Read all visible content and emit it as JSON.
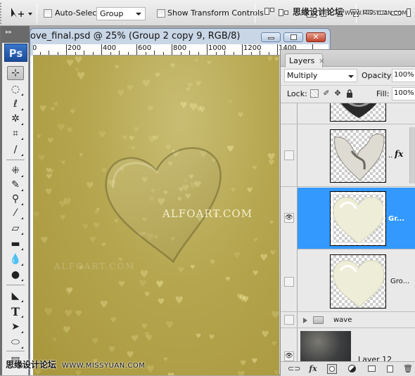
{
  "options_bar": {
    "auto_select_label": "Auto-Select:",
    "auto_select_checked": false,
    "auto_select_value": "Group",
    "show_transform_label": "Show Transform Controls",
    "show_transform_checked": false
  },
  "tools": {
    "panel_header": "▸▸",
    "logo": "Ps",
    "items": [
      {
        "name": "move-tool",
        "glyph": "⊹",
        "active": true
      },
      {
        "name": "marquee-tool",
        "glyph": "◌"
      },
      {
        "name": "lasso-tool",
        "glyph": "ℓ"
      },
      {
        "name": "magic-wand-tool",
        "glyph": "✲"
      },
      {
        "name": "crop-tool",
        "glyph": "⌗"
      },
      {
        "name": "eyedropper-tool",
        "glyph": "∕"
      },
      {
        "name": "healing-brush-tool",
        "glyph": "⁜"
      },
      {
        "name": "brush-tool",
        "glyph": "✎"
      },
      {
        "name": "clone-stamp-tool",
        "glyph": "⚲"
      },
      {
        "name": "history-brush-tool",
        "glyph": "⁄"
      },
      {
        "name": "eraser-tool",
        "glyph": "▱"
      },
      {
        "name": "gradient-tool",
        "glyph": "▬"
      },
      {
        "name": "blur-tool",
        "glyph": "💧"
      },
      {
        "name": "dodge-tool",
        "glyph": "●"
      },
      {
        "name": "pen-tool",
        "glyph": "◣"
      },
      {
        "name": "type-tool",
        "glyph": "T"
      },
      {
        "name": "path-selection-tool",
        "glyph": "➤"
      },
      {
        "name": "shape-tool",
        "glyph": "⬭"
      },
      {
        "name": "notes-tool",
        "glyph": "▤"
      }
    ]
  },
  "document": {
    "title": "ove_final.psd @ 25% (Group 2 copy 9, RGB/8)",
    "ruler_labels": [
      "0",
      "200",
      "400",
      "600",
      "800",
      "1000",
      "1200",
      "1400"
    ],
    "watermark_main": "ALFOART.COM",
    "watermark_faint": "ALFOART.COM"
  },
  "layers_panel": {
    "tab_label": "Layers",
    "tab_close": "×",
    "blend_mode": "Multiply",
    "opacity_label": "Opacity:",
    "opacity_value": "100%",
    "lock_label": "Lock:",
    "fill_label": "Fill:",
    "fill_value": "100%",
    "layers": [
      {
        "name": "",
        "visible": false,
        "selected": false,
        "thumb": "dark-heart-partial"
      },
      {
        "name": "..",
        "fx": "fx",
        "visible": false,
        "selected": false,
        "thumb": "broken-heart"
      },
      {
        "name": "Gr...",
        "visible": true,
        "selected": true,
        "thumb": "glass-heart"
      },
      {
        "name": "Gro...",
        "visible": false,
        "selected": false,
        "thumb": "glass-heart"
      },
      {
        "name": "wave",
        "visible": false,
        "selected": false,
        "type": "group"
      },
      {
        "name": "Layer 12",
        "visible": true,
        "selected": false,
        "thumb": "dark-sparkle"
      }
    ],
    "footer_icons": [
      "link-icon",
      "fx-icon",
      "mask-icon",
      "adjustment-icon",
      "group-folder-icon",
      "new-layer-icon",
      "trash-icon"
    ],
    "fx_label": "fx"
  },
  "watermarks": {
    "cn_text": "思缘设计论坛",
    "cn_url": "WWW.MISSYUAN.COM",
    "top_text": "思缘设计论坛",
    "top_url": "WWW.MISSYUAN.COM"
  }
}
